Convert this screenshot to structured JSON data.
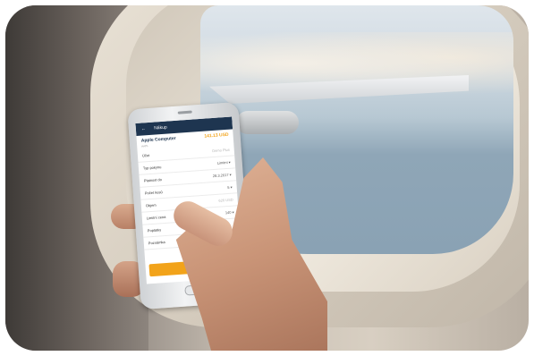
{
  "app": {
    "title": "Nákup",
    "back_icon": "arrow-left-icon",
    "stock_name": "Apple Computer",
    "ticker": "AAPL",
    "price": "141.13 USD",
    "buy_button_label": ""
  },
  "form": {
    "rows": [
      {
        "label": "Účet",
        "value": "Demo Plus",
        "muted": true
      },
      {
        "label": "Typ pokynu",
        "value": "Limitní ▾",
        "muted": false
      },
      {
        "label": "Platnost do",
        "value": "28.3.2017 ▾",
        "muted": false
      },
      {
        "label": "Počet kusů",
        "value": "5 ▾",
        "muted": false
      },
      {
        "label": "Objem",
        "value": "620 USD",
        "muted": true
      },
      {
        "label": "Limitní cena",
        "value": "140 ▾",
        "muted": false
      },
      {
        "label": "Poplatky",
        "value": "",
        "muted": false
      },
      {
        "label": "Poznámka",
        "value": "",
        "muted": false
      }
    ]
  },
  "colors": {
    "app_bar": "#1e3550",
    "accent": "#f2a31a"
  }
}
